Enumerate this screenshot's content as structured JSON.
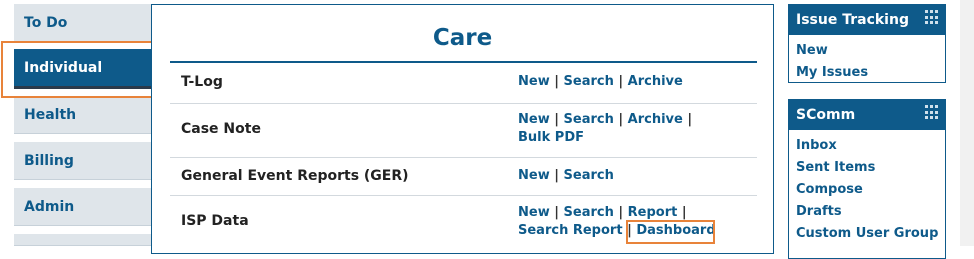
{
  "nav": {
    "tabs": [
      {
        "label": "To Do"
      },
      {
        "label": "Individual"
      },
      {
        "label": "Health"
      },
      {
        "label": "Billing"
      },
      {
        "label": "Admin"
      }
    ]
  },
  "main": {
    "title": "Care",
    "rows": [
      {
        "label": "T-Log",
        "links": [
          "New",
          "Search",
          "Archive"
        ]
      },
      {
        "label": "Case Note",
        "links": [
          "New",
          "Search",
          "Archive",
          "Bulk PDF"
        ]
      },
      {
        "label": "General Event Reports (GER)",
        "links": [
          "New",
          "Search"
        ]
      },
      {
        "label": "ISP Data",
        "links": [
          "New",
          "Search",
          "Report",
          "Search Report",
          "Dashboard"
        ]
      }
    ]
  },
  "sidebar": {
    "issue_tracking": {
      "title": "Issue Tracking",
      "items": [
        "New",
        "My Issues"
      ]
    },
    "scomm": {
      "title": "SComm",
      "items": [
        "Inbox",
        "Sent Items",
        "Compose",
        "Drafts",
        "Custom User Group"
      ]
    }
  },
  "colors": {
    "accent": "#0e5a8a",
    "highlight": "#e8833a",
    "tab_bg": "#dfe5ea"
  }
}
